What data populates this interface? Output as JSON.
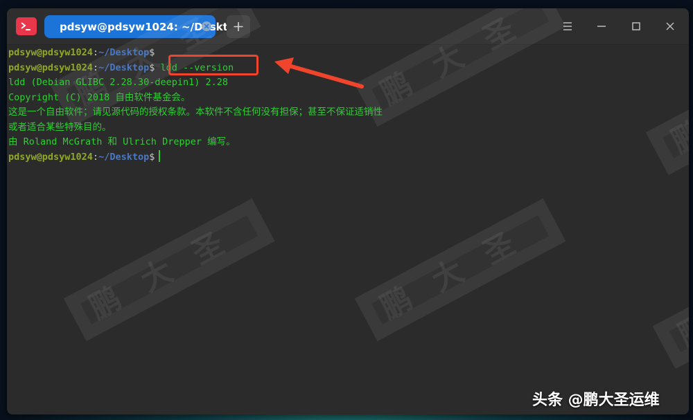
{
  "window": {
    "tab_title": "pdsyw@pdsyw1024: ~/Desktop",
    "new_tab_symbol": "+",
    "app_icon": "terminal-icon",
    "controls": [
      "menu-icon",
      "minimize-icon",
      "maximize-icon",
      "close-icon"
    ]
  },
  "prompt": {
    "user": "pdsyw@pdsyw1024",
    "colon": ":",
    "path": "~/Desktop",
    "dollar": "$"
  },
  "terminal": {
    "command": "ldd --version",
    "output": [
      "ldd (Debian GLIBC 2.28.30-deepin1) 2.28",
      "Copyright (C) 2018 自由软件基金会。",
      "这是一个自由软件；请见源代码的授权条款。本软件不含任何没有担保；甚至不保证适销性",
      "或者适合某些特殊目的。",
      "由 Roland McGrath 和 Ulrich Drepper 编写。"
    ]
  },
  "watermark": "鹏大圣",
  "credit": "头条 @鹏大圣运维",
  "colors": {
    "prompt_user": "#8fa826",
    "prompt_path": "#4a78c2",
    "output_green": "#2fcf34",
    "tab_blue": "#1d74d8",
    "annotation_red": "#f0452c"
  }
}
